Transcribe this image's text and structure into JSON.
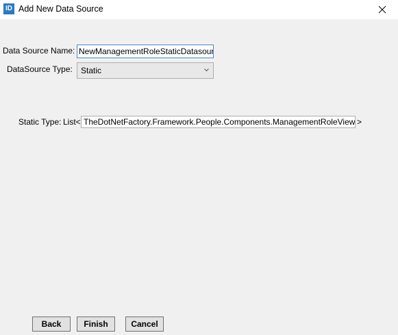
{
  "window": {
    "title": "Add New Data Source",
    "icon_label": "ID",
    "icon": "app-icon",
    "close_icon": "close-icon"
  },
  "form": {
    "name_label": "Data Source Name:",
    "name_value": "NewManagementRoleStaticDatasource",
    "type_label": "DataSource Type:",
    "type_value": "Static",
    "static_type_label": "Static Type:",
    "list_prefix": "List<",
    "static_type_value": "TheDotNetFactory.Framework.People.Components.ManagementRoleView",
    "list_suffix": ">"
  },
  "buttons": {
    "back": "Back",
    "finish": "Finish",
    "cancel": "Cancel"
  },
  "colors": {
    "window_bg": "#f0f0f0",
    "titlebar_bg": "#ffffff",
    "accent": "#2a7ac0",
    "input_focus_border": "#4a86c8"
  }
}
